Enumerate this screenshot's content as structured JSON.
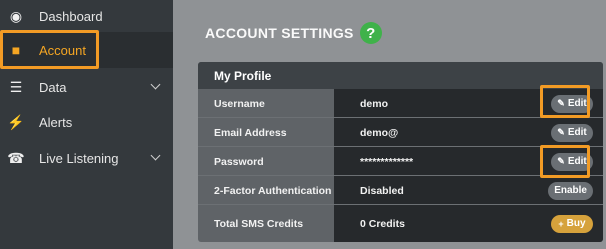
{
  "sidebar": {
    "items": [
      {
        "label": "Dashboard",
        "icon": "dashboard-icon"
      },
      {
        "label": "Account",
        "icon": "user-icon",
        "active": true
      },
      {
        "label": "Data",
        "icon": "database-icon"
      },
      {
        "label": "Alerts",
        "icon": "bolt-icon"
      },
      {
        "label": "Live Listening",
        "icon": "phone-gear-icon"
      }
    ]
  },
  "main": {
    "title": "ACCOUNT SETTINGS",
    "help_glyph": "?"
  },
  "profile": {
    "header": "My Profile",
    "rows": [
      {
        "label": "Username",
        "value": "demo",
        "button": "Edit"
      },
      {
        "label": "Email Address",
        "value": "demo@",
        "button": "Edit"
      },
      {
        "label": "Password",
        "value": "*************",
        "button": "Edit"
      },
      {
        "label": "2-Factor Authentication",
        "value": "Disabled",
        "button": "Enable"
      },
      {
        "label": "Total SMS Credits",
        "value": "0 Credits",
        "button": "Buy"
      }
    ]
  },
  "colors": {
    "accent": "#f29b25",
    "help": "#3fb24a",
    "buy": "#d6a23c"
  }
}
